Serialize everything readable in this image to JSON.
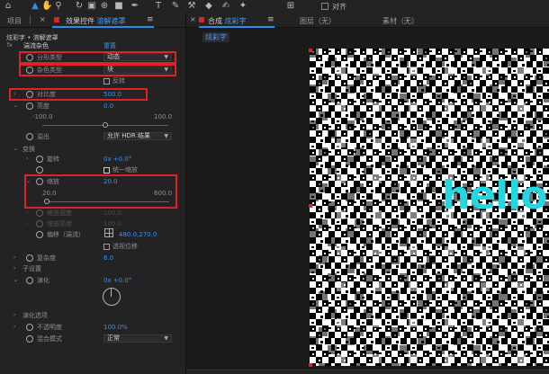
{
  "colors": {
    "accent": "#2d8ceb",
    "value_blue": "#3f8fe6",
    "highlight": "#e0202a",
    "hello_text": "#23d6e0"
  },
  "toolbar": {
    "icons": [
      "home-icon",
      "selection-tool-icon",
      "hand-tool-icon",
      "zoom-tool-icon",
      "rotate-tool-icon",
      "camera-tool-icon",
      "pan-behind-tool-icon",
      "rectangle-tool-icon",
      "pen-tool-icon",
      "type-tool-icon",
      "brush-tool-icon",
      "clone-stamp-icon",
      "eraser-tool-icon",
      "roto-brush-icon",
      "puppet-pin-icon"
    ],
    "snap_label": "对齐"
  },
  "effects_panel": {
    "tab_project": "项目",
    "tab_effect_prefix": "效果控件",
    "tab_effect_layer": "溶解遮罩",
    "breadcrumb": "炫彩字 • 溶解遮罩",
    "effect": {
      "name": "湍流杂色",
      "reset": "重置"
    },
    "props": {
      "fractal_type": {
        "label": "分形类型",
        "value": "动态"
      },
      "noise_type": {
        "label": "杂色类型",
        "value": "块"
      },
      "invert": {
        "label": "反转"
      },
      "contrast": {
        "label": "对比度",
        "value": "500.0"
      },
      "brightness": {
        "label": "亮度",
        "value": "0.0",
        "min": "-100.0",
        "max": "100.0",
        "level": 0.5
      },
      "overflow": {
        "label": "溢出",
        "value": "允许 HDR 结果"
      },
      "transform": {
        "label": "变换"
      },
      "rotation": {
        "label": "旋转",
        "value": "0x +0.0°"
      },
      "uniform_scale": {
        "label": "统一缩放"
      },
      "scale": {
        "label": "缩放",
        "value": "20.0",
        "min": "20.0",
        "max": "600.0",
        "level": 0.0
      },
      "scale_width": {
        "label": "缩放宽度",
        "value": "100.0"
      },
      "scale_height": {
        "label": "缩放高度",
        "value": "100.0"
      },
      "offset": {
        "label": "偏移（湍流）",
        "value": "480.0,270.0"
      },
      "perspective": {
        "label": "透视位移"
      },
      "complexity": {
        "label": "复杂度",
        "value": "6.0"
      },
      "sub_settings": {
        "label": "子设置"
      },
      "evolution": {
        "label": "演化",
        "value": "0x +0.0°"
      },
      "evolution_options": {
        "label": "演化选项"
      },
      "opacity": {
        "label": "不透明度",
        "value": "100.0%"
      },
      "blend_mode": {
        "label": "混合模式",
        "value": "正常"
      }
    }
  },
  "comp_panel": {
    "tab_comp_prefix": "合成",
    "tab_comp_name": "炫彩字",
    "tab_layer": "图层（无）",
    "tab_footage": "素材（无）",
    "comp_chip": "炫彩字",
    "viewer_text": "hello"
  }
}
